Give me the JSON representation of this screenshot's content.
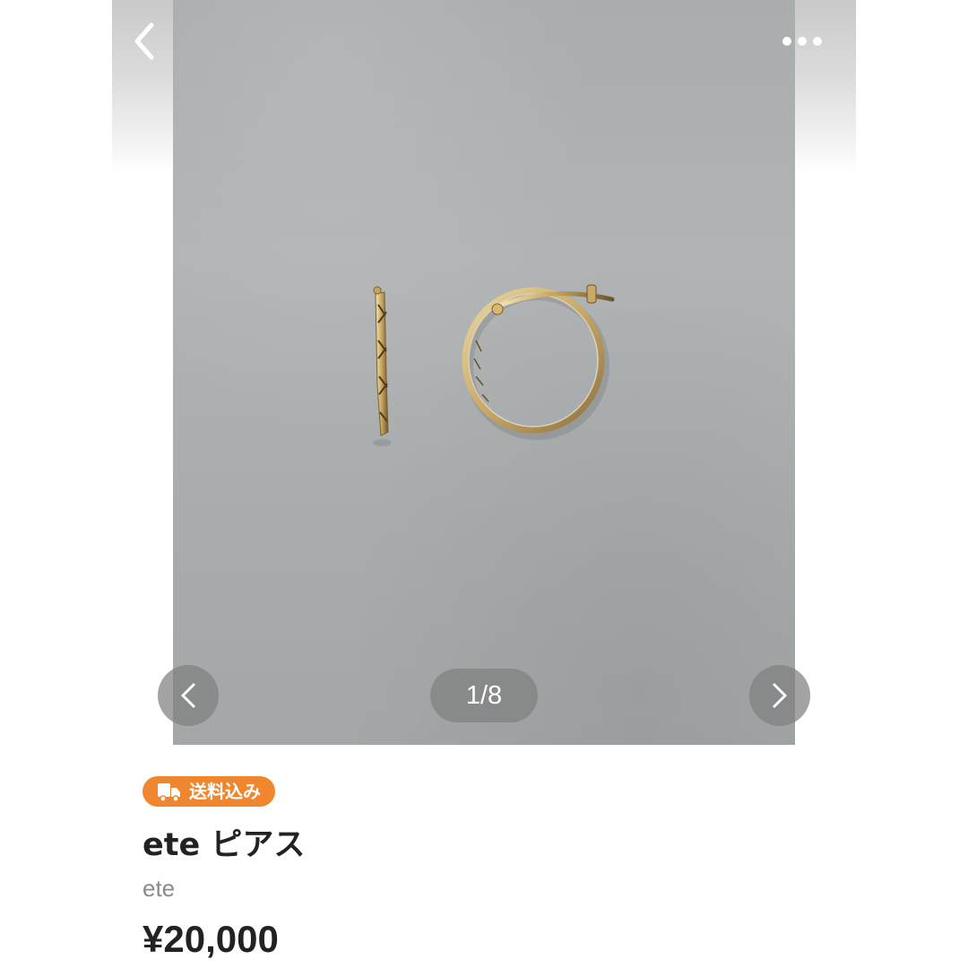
{
  "header": {
    "back_icon": "chevron-left-icon",
    "more_icon": "ellipsis-horizontal-icon"
  },
  "gallery": {
    "image_subject": "gold hoop earrings on grey surface",
    "counter": "1/8",
    "current": 1,
    "total": 8,
    "prev_icon": "chevron-left-icon",
    "next_icon": "chevron-right-icon"
  },
  "product": {
    "shipping_badge": "送料込み",
    "shipping_icon": "truck-icon",
    "title": "ete ピアス",
    "brand": "ete",
    "price": "¥20,000"
  },
  "colors": {
    "badge": "#f0872e",
    "photo_background": "#abafb0",
    "overlay": "#808080",
    "text_primary": "#222222",
    "text_secondary": "#8a8a8a"
  }
}
